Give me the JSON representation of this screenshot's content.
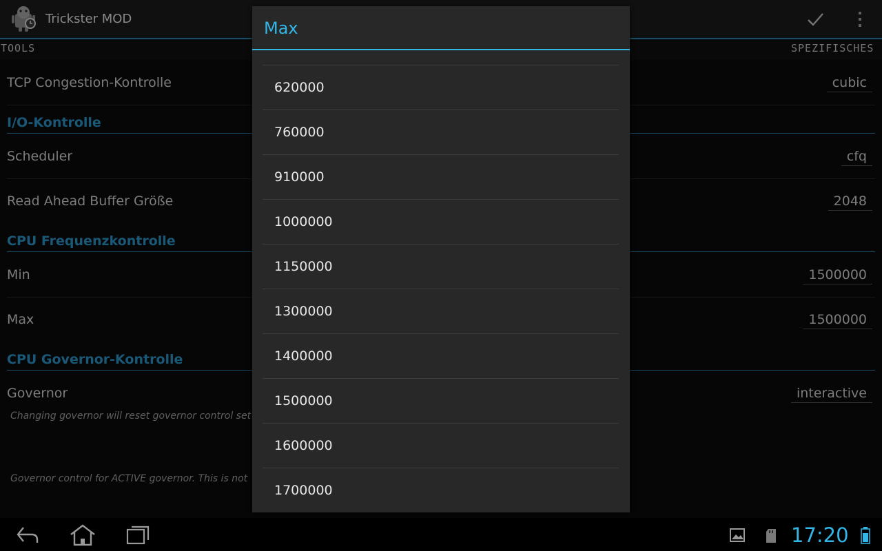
{
  "app": {
    "title": "Trickster MOD"
  },
  "tabs": {
    "left": "TOOLS",
    "right": "SPEZIFISCHES"
  },
  "settings": {
    "tcp_label": "TCP Congestion-Kontrolle",
    "tcp_value": "cubic",
    "io_section": "I/O-Kontrolle",
    "scheduler_label": "Scheduler",
    "scheduler_value": "cfq",
    "readahead_label": "Read Ahead Buffer Größe",
    "readahead_value": "2048",
    "cpu_freq_section": "CPU Frequenzkontrolle",
    "min_label": "Min",
    "min_value": "1500000",
    "max_label": "Max",
    "max_value": "1500000",
    "governor_section": "CPU Governor-Kontrolle",
    "governor_label": "Governor",
    "governor_value": "interactive",
    "governor_hint": "Changing governor will reset governor control set",
    "governor_control_hint": "Governor control for ACTIVE governor. This is not"
  },
  "dialog": {
    "title": "Max",
    "options": [
      "620000",
      "760000",
      "910000",
      "1000000",
      "1150000",
      "1300000",
      "1400000",
      "1500000",
      "1600000",
      "1700000"
    ]
  },
  "statusbar": {
    "clock": "17:20"
  },
  "colors": {
    "accent": "#33b5e5",
    "section": "#2b8ec0"
  },
  "icons": [
    "app-icon",
    "check-icon",
    "overflow-menu-icon",
    "back-icon",
    "home-icon",
    "recent-apps-icon",
    "gallery-icon",
    "sd-card-icon",
    "battery-icon"
  ]
}
